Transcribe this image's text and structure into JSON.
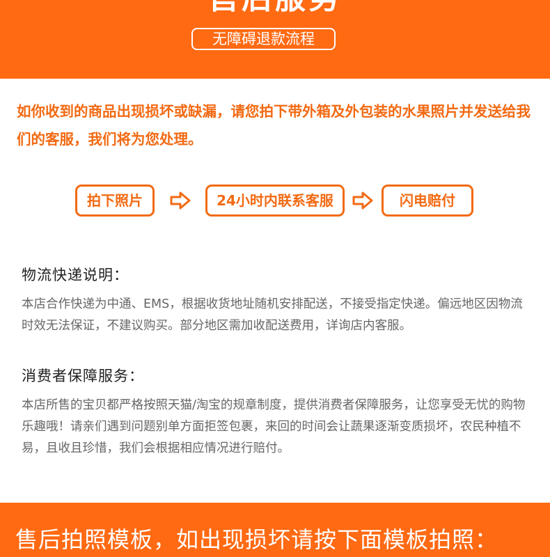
{
  "header": {
    "title": "售后服务",
    "subtitle": "无障碍退款流程"
  },
  "intro": {
    "text": "如你收到的商品出现损坏或缺漏，请您拍下带外箱及外包装的水果照片并发送给我们的客服，我们将为您处理。"
  },
  "steps": [
    {
      "label": "拍下照片"
    },
    {
      "label": "24小时内联系客服"
    },
    {
      "label": "闪电赔付"
    }
  ],
  "sections": [
    {
      "title": "物流快递说明：",
      "body": "本店合作快递为中通、EMS，根据收货地址随机安排配送，不接受指定快递。偏远地区因物流时效无法保证，不建议购买。部分地区需加收配送费用，详询店内客服。"
    },
    {
      "title": "消费者保障服务：",
      "body": "本店所售的宝贝都严格按照天猫/淘宝的规章制度，提供消费者保障服务，让您享受无忧的购物乐趣哦！请亲们遇到问题别单方面拒签包裹，来回的时间会让蔬果逐渐变质损坏，农民种植不易，且收且珍惜，我们会根据相应情况进行赔付。"
    }
  ],
  "footer": {
    "title": "售后拍照模板，如出现损坏请按下面模板拍照："
  },
  "colors": {
    "accent": "#ff6a13",
    "section_text": "#666666",
    "heading_text": "#222222"
  },
  "icons": [
    "arrow-right-icon"
  ]
}
